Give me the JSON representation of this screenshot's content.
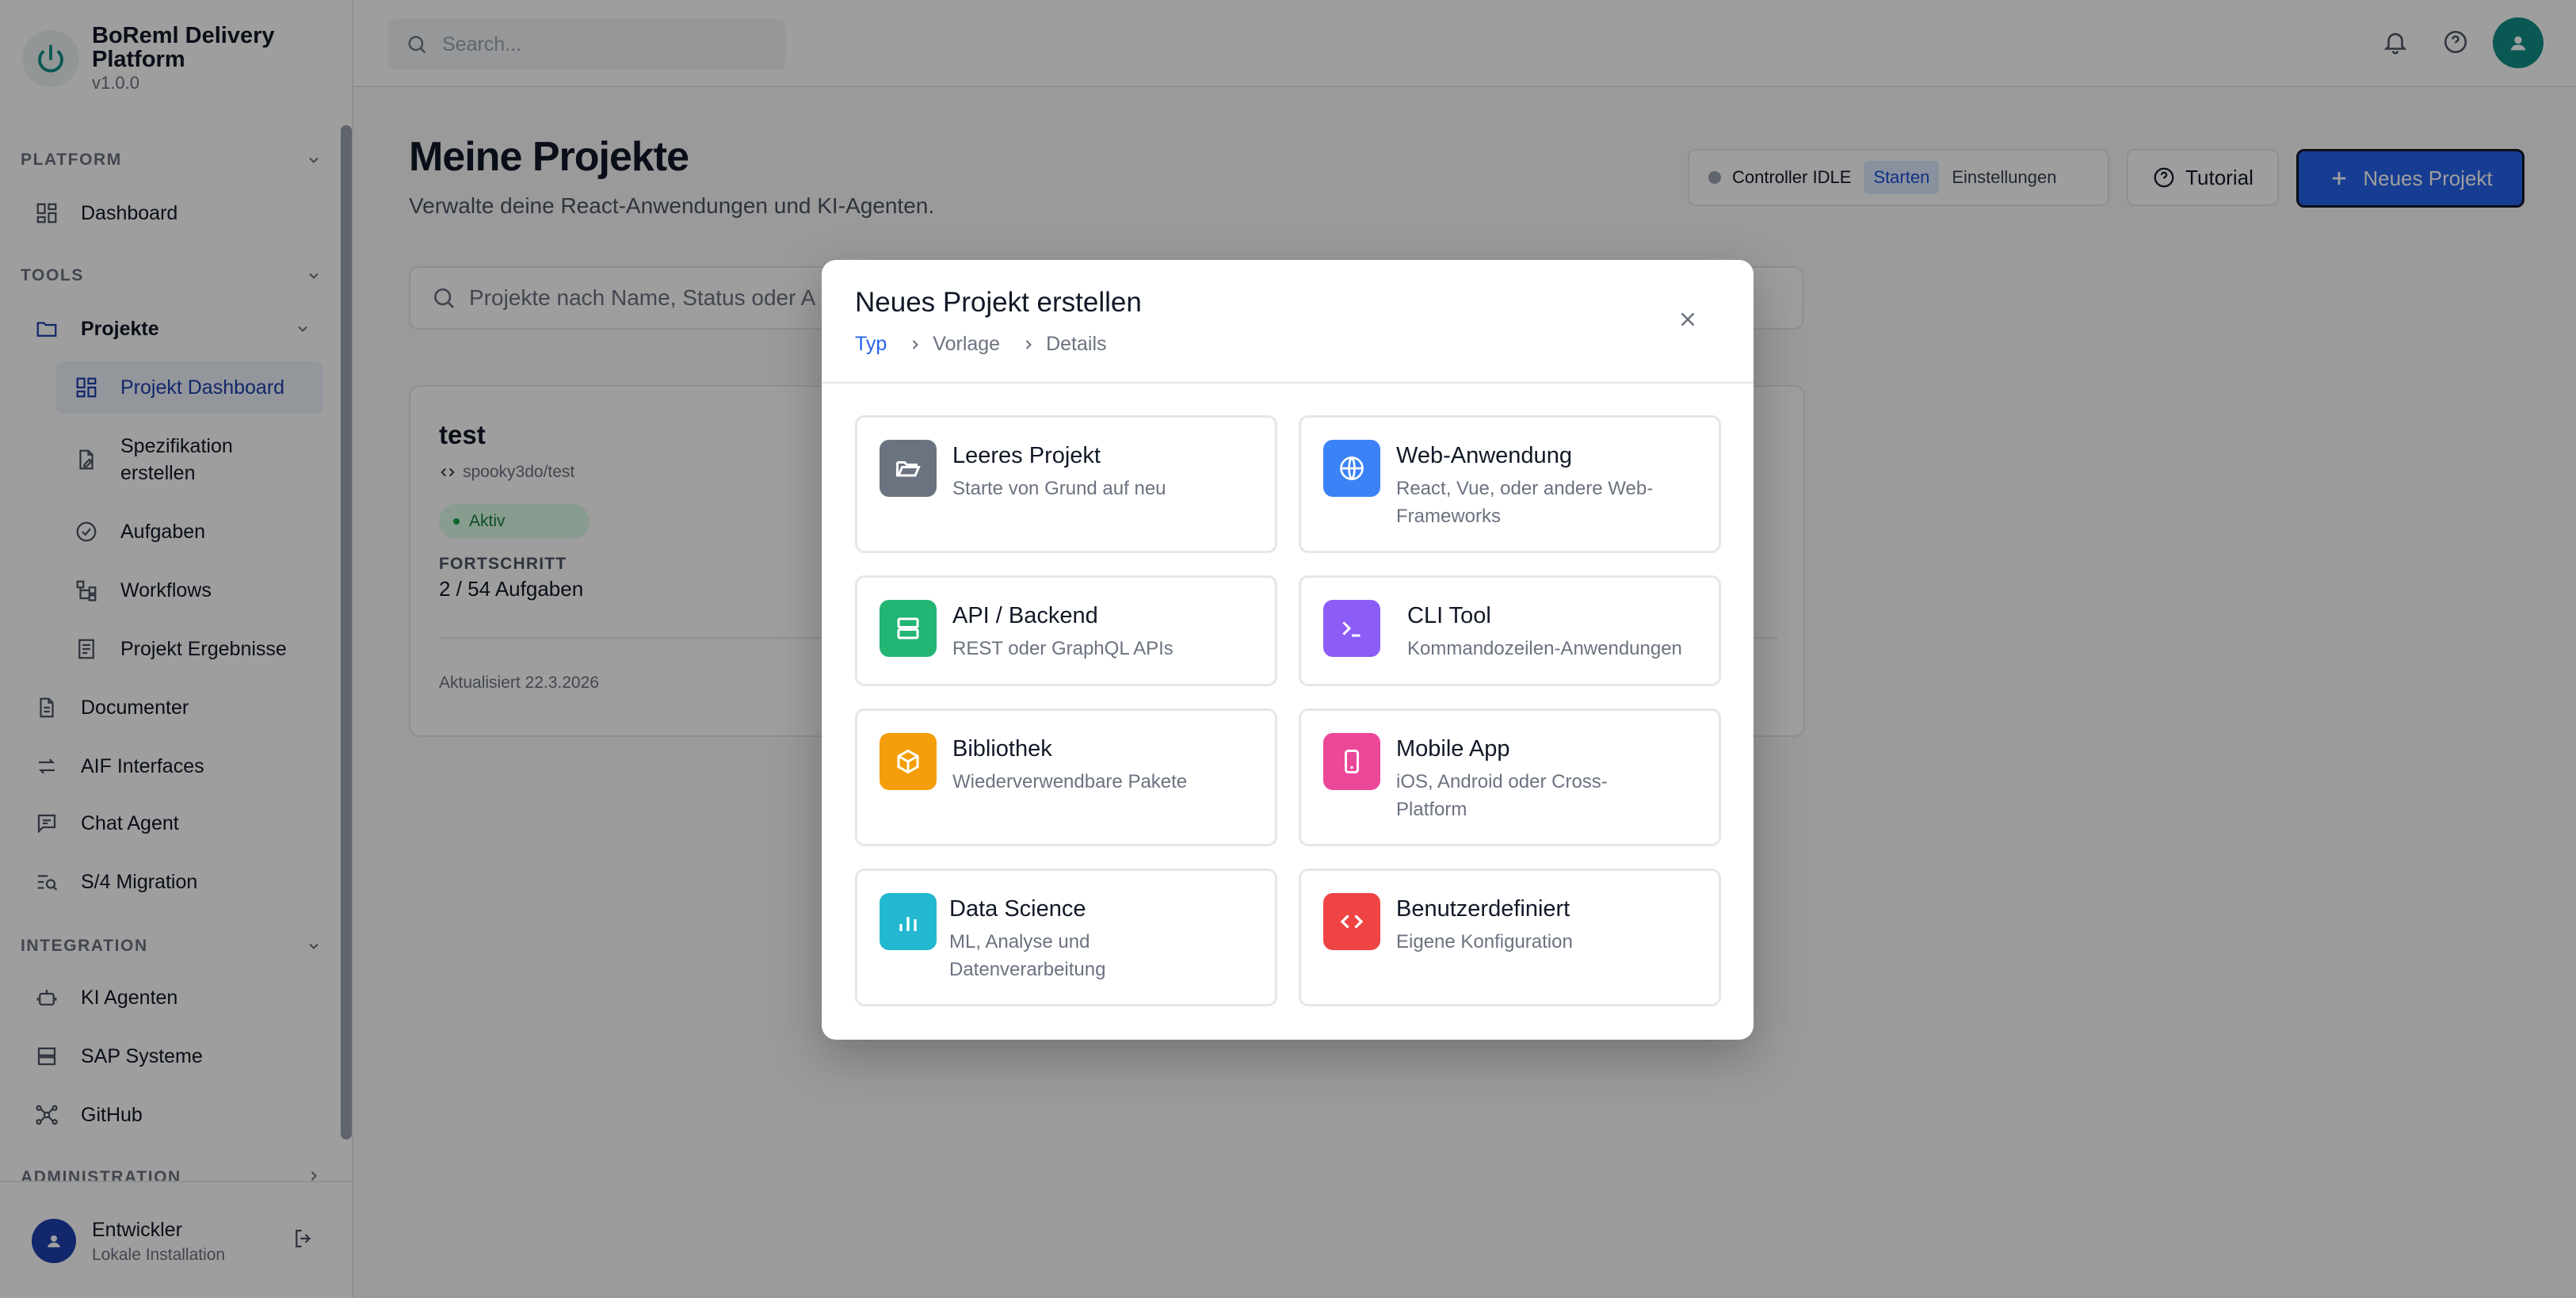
{
  "app": {
    "title": "BoReml Delivery Platform",
    "version": "v1.0.0"
  },
  "header": {
    "search_placeholder": "Search..."
  },
  "sidebar": {
    "sections": {
      "platform": "PLATFORM",
      "tools": "TOOLS",
      "integration": "INTEGRATION",
      "administration": "ADMINISTRATION"
    },
    "items": {
      "dashboard": "Dashboard",
      "projekte": "Projekte",
      "projekt_dashboard": "Projekt Dashboard",
      "spezifikation_l1": "Spezifikation",
      "spezifikation_l2": "erstellen",
      "aufgaben": "Aufgaben",
      "workflows": "Workflows",
      "ergebnisse": "Projekt Ergebnisse",
      "documenter": "Documenter",
      "aif": "AIF Interfaces",
      "chat": "Chat Agent",
      "s4": "S/4 Migration",
      "ki_agenten": "KI Agenten",
      "sap": "SAP Systeme",
      "github": "GitHub"
    },
    "user": {
      "name": "Entwickler",
      "subtitle": "Lokale Installation"
    }
  },
  "main": {
    "title": "Meine Projekte",
    "subtitle": "Verwalte deine React-Anwendungen und KI-Agenten.",
    "controller": {
      "status": "Controller IDLE",
      "start": "Starten",
      "settings": "Einstellungen"
    },
    "tutorial_label": "Tutorial",
    "new_project_label": "Neues Projekt",
    "project_search_placeholder": "Projekte nach Name, Status oder A",
    "project_card": {
      "name": "test",
      "repo": "spooky3do/test",
      "status": "Aktiv",
      "progress_label": "FORTSCHRITT",
      "progress_value": "2 / 54 Aufgaben",
      "updated": "Aktualisiert 22.3.2026"
    }
  },
  "modal": {
    "title": "Neues Projekt erstellen",
    "steps": [
      "Typ",
      "Vorlage",
      "Details"
    ],
    "options": [
      {
        "title": "Leeres Projekt",
        "desc": "Starte von Grund auf neu",
        "icon": "folder-open-icon",
        "color": "#6b7280"
      },
      {
        "title": "Web-Anwendung",
        "desc": "React, Vue, oder andere Web-Frameworks",
        "icon": "globe-icon",
        "color": "#3b82f6"
      },
      {
        "title": "API / Backend",
        "desc": "REST oder GraphQL APIs",
        "icon": "server-icon",
        "color": "#22b573"
      },
      {
        "title": "CLI Tool",
        "desc": "Kommandozeilen-Anwendungen",
        "icon": "terminal-icon",
        "color": "#8b5cf6"
      },
      {
        "title": "Bibliothek",
        "desc": "Wiederverwendbare Pakete",
        "icon": "package-icon",
        "color": "#f59e0b"
      },
      {
        "title": "Mobile App",
        "desc": "iOS, Android oder Cross-Platform",
        "icon": "smartphone-icon",
        "color": "#ec4899"
      },
      {
        "title": "Data Science",
        "desc": "ML, Analyse und Datenverarbeitung",
        "icon": "bar-chart-icon",
        "color": "#22b8cf"
      },
      {
        "title": "Benutzerdefiniert",
        "desc": "Eigene Konfiguration",
        "icon": "code-icon",
        "color": "#ef4444"
      }
    ]
  }
}
